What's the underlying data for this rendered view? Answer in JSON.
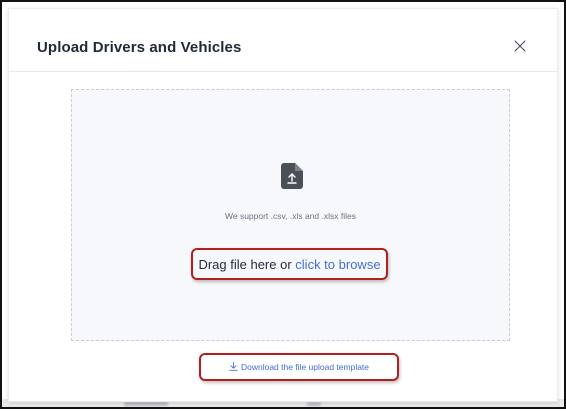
{
  "modal": {
    "title": "Upload Drivers and Vehicles",
    "close_icon": "close-icon"
  },
  "dropzone": {
    "icon": "file-upload-icon",
    "support_text": "We support .csv, .xls and .xlsx files",
    "drag_text": "Drag file here or",
    "browse_text": "click to browse"
  },
  "template": {
    "icon": "download-icon",
    "label": "Download the file upload template"
  },
  "colors": {
    "accent": "#3f6fd8",
    "highlight_border": "#b21f1f",
    "dropzone_bg": "#f7f8fc"
  }
}
